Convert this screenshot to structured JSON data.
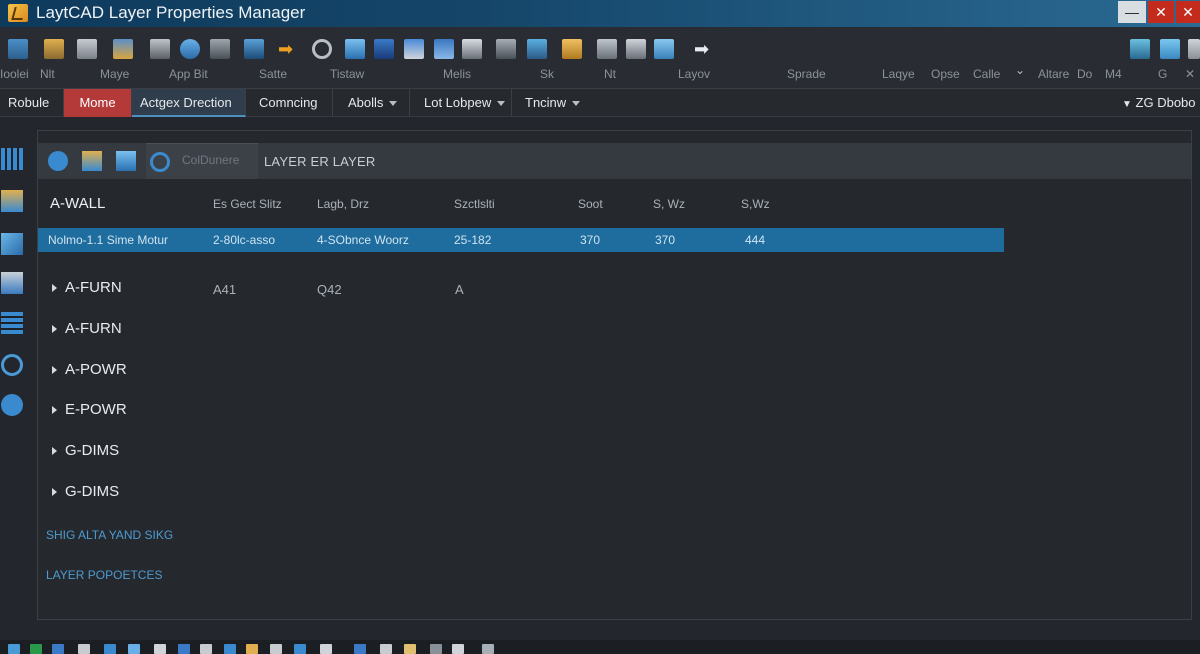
{
  "window": {
    "title": "LaytCAD Layer Properties Manager",
    "min_glyph": "—",
    "max_glyph": "✕",
    "close_glyph": "✕"
  },
  "toolbar": {
    "labels": [
      "Ioolei",
      "Nlt",
      "Maye",
      "App Bit",
      "Satte",
      "Tistaw",
      "Melis",
      "Sk",
      "Nt",
      "Layov",
      "Sprade",
      "Laqye",
      "Opse",
      "Calle",
      "Altare",
      "Do",
      "M4",
      "G"
    ],
    "arrow_glyph": "➡",
    "right_arrow_glyph": "➡",
    "chevron_glyph": "⌄",
    "close_glyph": "✕"
  },
  "tabs": {
    "items": [
      "Robule",
      "Mome",
      "Actgex Drection",
      "Comncing",
      "Abolls",
      "Lot Lobpew",
      "Tncinw"
    ],
    "right_label": "ZG Dbobo",
    "right_glyph": "▼"
  },
  "panel": {
    "filter_placeholder": "ColDunere",
    "title": "LAYER ER LAYER",
    "header": {
      "name": "A-WALL",
      "cols": [
        "Es Gect Slitz",
        "Lagb, Drz",
        "Szctlslti",
        "Soot",
        "S, Wz",
        "S,Wz"
      ]
    },
    "selected_row": {
      "cells": [
        "Nolmo-1.1 Sime Motur",
        "2-80lc-asso",
        "4-SObnce Woorz",
        "25-182",
        "370",
        "370",
        "444"
      ]
    },
    "layers": [
      {
        "name": "A-FURN",
        "c1": "A41",
        "c2": "Q42",
        "c3": "A"
      },
      {
        "name": "A-FURN"
      },
      {
        "name": "A-POWR"
      },
      {
        "name": "E-POWR"
      },
      {
        "name": "G-DIMS"
      },
      {
        "name": "G-DIMS"
      }
    ],
    "links": [
      "SHIG ALTA YAND SIKG",
      "LAYER POPOETCES"
    ]
  },
  "colors": {
    "accent": "#1f6d9e",
    "home_tab": "#b43a3a",
    "titlebar": "#15466a",
    "link": "#4e9ad0"
  },
  "icons": {
    "app": "laytcad-logo-icon",
    "add": "add-circle-icon",
    "new_layer": "new-layer-icon",
    "save": "save-icon",
    "filter": "filter-circle-icon"
  }
}
